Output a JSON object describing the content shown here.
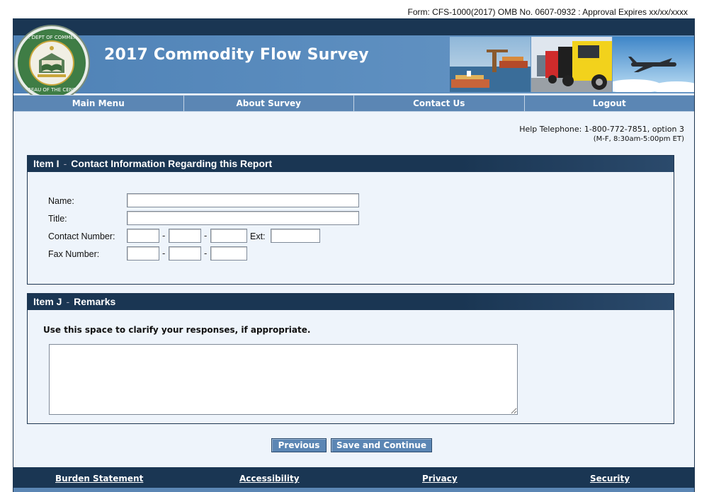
{
  "form_line": "Form: CFS-1000(2017) OMB No. 0607-0932 : Approval Expires  xx/xx/xxxx",
  "header": {
    "title": "2017 Commodity Flow Survey",
    "seal_text": "U.S. DEPARTMENT OF COMMERCE · BUREAU OF THE CENSUS"
  },
  "nav": {
    "items": [
      {
        "label": "Main Menu"
      },
      {
        "label": "About Survey"
      },
      {
        "label": "Contact Us"
      },
      {
        "label": "Logout"
      }
    ]
  },
  "help": {
    "telephone": "Help Telephone: 1-800-772-7851, option 3",
    "hours": "(M-F, 8:30am-5:00pm ET)"
  },
  "item_i": {
    "label": "Item I",
    "separator": "-",
    "title": "Contact Information Regarding this Report",
    "name_label": "Name:",
    "title_label": "Title:",
    "contact_label": "Contact Number:",
    "ext_label": "Ext:",
    "fax_label": "Fax Number:",
    "dash": "-",
    "name_value": "",
    "title_value": "",
    "contact_area": "",
    "contact_prefix": "",
    "contact_line": "",
    "contact_ext": "",
    "fax_area": "",
    "fax_prefix": "",
    "fax_line": ""
  },
  "item_j": {
    "label": "Item J",
    "separator": "-",
    "title": "Remarks",
    "instructions": "Use this space to clarify your responses, if appropriate.",
    "remarks_value": ""
  },
  "buttons": {
    "previous": "Previous",
    "save_continue": "Save and Continue"
  },
  "footer": {
    "links": [
      {
        "label": "Burden Statement"
      },
      {
        "label": "Accessibility"
      },
      {
        "label": "Privacy"
      },
      {
        "label": "Security"
      }
    ]
  },
  "colors": {
    "navy": "#1a3653",
    "nav_blue": "#5b86b4",
    "page_bg": "#eef4fb"
  }
}
